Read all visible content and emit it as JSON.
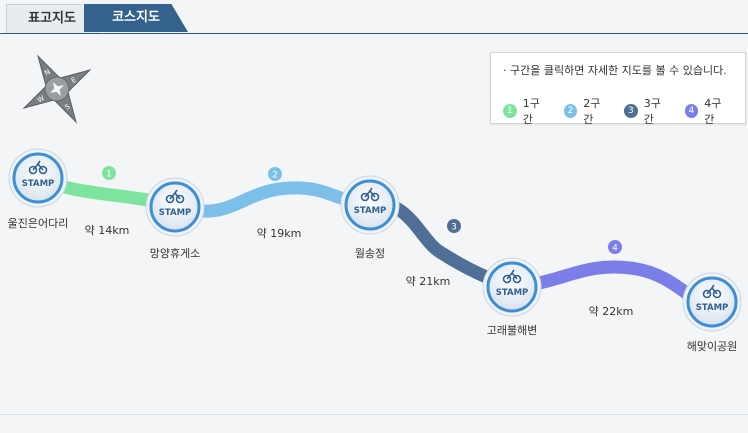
{
  "tabs": [
    {
      "label": "표고지도",
      "active": false
    },
    {
      "label": "코스지도",
      "active": true
    }
  ],
  "legend": {
    "note": "· 구간을 클릭하면 자세한 지도를 볼 수 있습니다.",
    "items": [
      {
        "num": "1",
        "label": "1구간",
        "color": "#7fe3a0"
      },
      {
        "num": "2",
        "label": "2구간",
        "color": "#7cc0ea"
      },
      {
        "num": "3",
        "label": "3구간",
        "color": "#4f6f97"
      },
      {
        "num": "4",
        "label": "4구간",
        "color": "#7b7ee6"
      }
    ]
  },
  "stamp_text": "STAMP",
  "stations": [
    {
      "name": "울진은어다리"
    },
    {
      "name": "망양휴게소"
    },
    {
      "name": "월송정"
    },
    {
      "name": "고래불해변"
    },
    {
      "name": "해맞이공원"
    }
  ],
  "segments": [
    {
      "num": "1",
      "distance": "약 14km",
      "color": "#7fe3a0"
    },
    {
      "num": "2",
      "distance": "약 19km",
      "color": "#7cc0ea"
    },
    {
      "num": "3",
      "distance": "약 21km",
      "color": "#4f6f97"
    },
    {
      "num": "4",
      "distance": "약 22km",
      "color": "#7b7ee6"
    }
  ],
  "compass": {
    "letters": [
      "N",
      "E",
      "S",
      "W"
    ]
  }
}
